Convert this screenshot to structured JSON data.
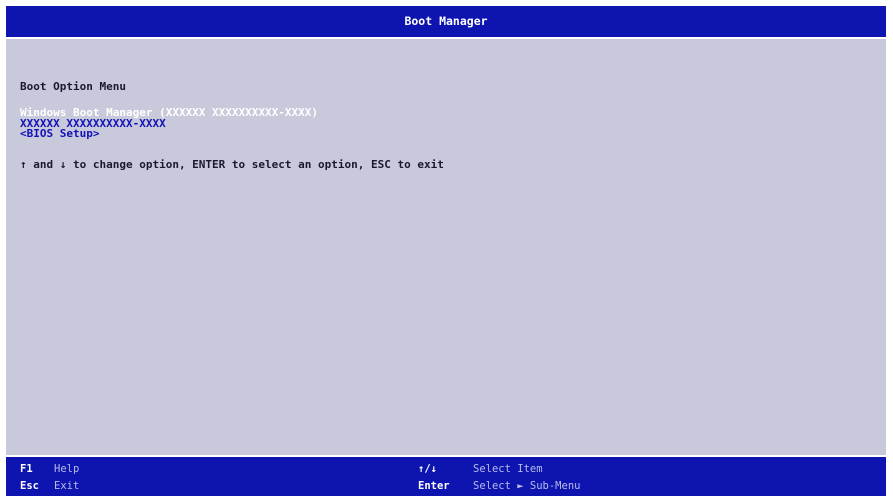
{
  "header": {
    "title": "Boot Manager"
  },
  "menu": {
    "title": "Boot Option Menu",
    "options": [
      {
        "label": "Windows Boot Manager (XXXXXX XXXXXXXXXX-XXXX)",
        "selected": true
      },
      {
        "label": "XXXXXX XXXXXXXXXX-XXXX",
        "selected": false
      },
      {
        "label": "<BIOS Setup>",
        "selected": false
      }
    ],
    "hint": "↑ and ↓ to change option, ENTER to select an option, ESC to exit"
  },
  "footer": {
    "help_key": "F1",
    "help_label": "Help",
    "exit_key": "Esc",
    "exit_label": "Exit",
    "nav_key": "↑/↓",
    "nav_label": "Select Item",
    "enter_key": "Enter",
    "enter_label": "Select ► Sub-Menu"
  },
  "colors": {
    "title_bar": "#0e14b0",
    "background": "#c8c9da",
    "option_text": "#1212b8",
    "selected_option_text": "#ffffff"
  }
}
